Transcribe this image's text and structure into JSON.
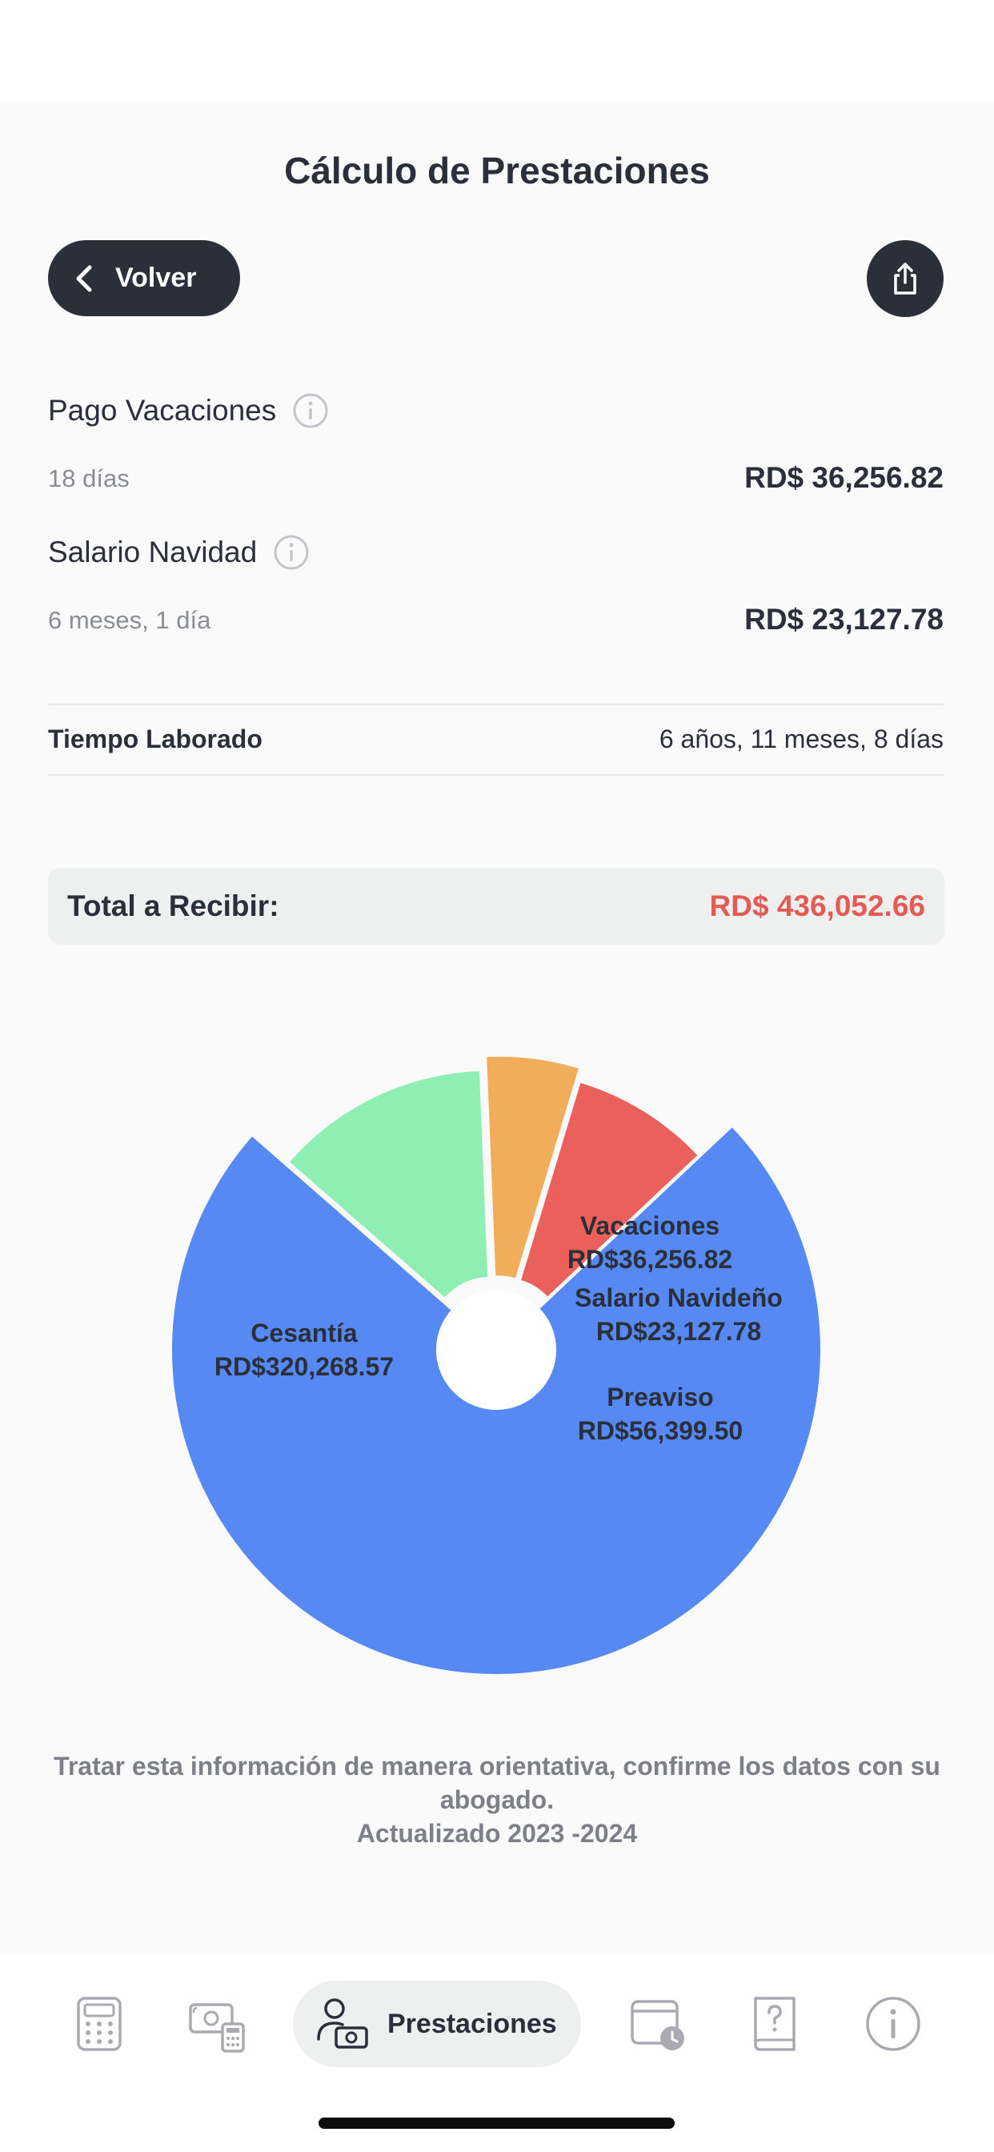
{
  "header": {
    "title": "Cálculo de Prestaciones",
    "back_label": "Volver"
  },
  "items": [
    {
      "label": "Pago Vacaciones",
      "sub": "18 días",
      "amount": "RD$ 36,256.82"
    },
    {
      "label": "Salario Navidad",
      "sub": "6 meses, 1 día",
      "amount": "RD$ 23,127.78"
    }
  ],
  "tiempo": {
    "label": "Tiempo Laborado",
    "value": "6 años, 11 meses, 8 días"
  },
  "total": {
    "label": "Total a Recibir:",
    "value": "RD$ 436,052.66"
  },
  "chart_data": {
    "type": "pie",
    "series": [
      {
        "name": "Cesantía",
        "label": "RD$320,268.57",
        "value": 320268.57,
        "color": "#5689f4"
      },
      {
        "name": "Preaviso",
        "label": "RD$56,399.50",
        "value": 56399.5,
        "color": "#8fefb3"
      },
      {
        "name": "Salario Navideño",
        "label": "RD$23,127.78",
        "value": 23127.78,
        "color": "#f2ad5b"
      },
      {
        "name": "Vacaciones",
        "label": "RD$36,256.82",
        "value": 36256.82,
        "color": "#eb605a"
      }
    ]
  },
  "disclaimer": {
    "line1": "Tratar esta información de manera orientativa, confirme los datos con su abogado.",
    "line2": "Actualizado 2023 -2024"
  },
  "tabbar": {
    "active_label": "Prestaciones",
    "icons": [
      "calculator-icon",
      "money-calculator-icon",
      "person-money-icon",
      "calendar-clock-icon",
      "help-book-icon",
      "info-icon"
    ]
  },
  "colors": {
    "dark": "#2b2f3a",
    "accent_red": "#e45a55",
    "muted": "#8a8d94"
  }
}
